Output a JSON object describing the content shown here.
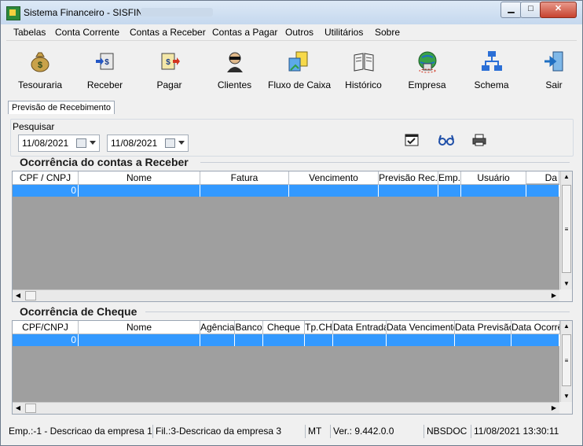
{
  "window": {
    "title": "Sistema Financeiro - SISFIN"
  },
  "menu": [
    "Tabelas",
    "Conta Corrente",
    "Contas a Receber",
    "Contas a Pagar",
    "Outros",
    "Utilitários",
    "Sobre"
  ],
  "toolbar": [
    {
      "label": "Tesouraria",
      "icon": "money-bag-icon"
    },
    {
      "label": "Receber",
      "icon": "receive-icon"
    },
    {
      "label": "Pagar",
      "icon": "pay-icon"
    },
    {
      "label": "Clientes",
      "icon": "client-icon"
    },
    {
      "label": "Fluxo de Caixa",
      "icon": "cash-flow-icon"
    },
    {
      "label": "Histórico",
      "icon": "history-book-icon"
    },
    {
      "label": "Empresa",
      "icon": "company-globe-icon"
    },
    {
      "label": "Schema",
      "icon": "schema-icon"
    },
    {
      "label": "Sair",
      "icon": "exit-icon"
    }
  ],
  "tab": {
    "label": "Previsão de Recebimento"
  },
  "search": {
    "title": "Pesquisar",
    "date_from": "11/08/2021",
    "date_to": "11/08/2021"
  },
  "receber": {
    "title": "Ocorrência do contas a Receber",
    "columns": [
      "CPF / CNPJ",
      "Nome",
      "Fatura",
      "Vencimento",
      "Previsão Rec.",
      "Emp.",
      "Usuário",
      "Da"
    ],
    "row": [
      "0",
      "",
      "",
      "",
      "",
      "",
      "",
      ""
    ]
  },
  "cheque": {
    "title": "Ocorrência de Cheque",
    "columns": [
      "CPF/CNPJ",
      "Nome",
      "Agência",
      "Banco",
      "Cheque",
      "Tp.CH",
      "Data Entrada",
      "Data Vencimento",
      "Data Previsão",
      "Data Ocorrê"
    ],
    "row": [
      "0",
      "",
      "",
      "",
      "",
      "",
      "",
      "",
      "",
      ""
    ]
  },
  "status": {
    "emp": "Emp.:-1 - Descricao da empresa 1",
    "fil": "Fil.:3-Descricao da empresa 3",
    "uf": "MT",
    "version": "Ver.: 9.442.0.0",
    "doc": "NBSDOC",
    "datetime": "11/08/2021 13:30:11"
  }
}
